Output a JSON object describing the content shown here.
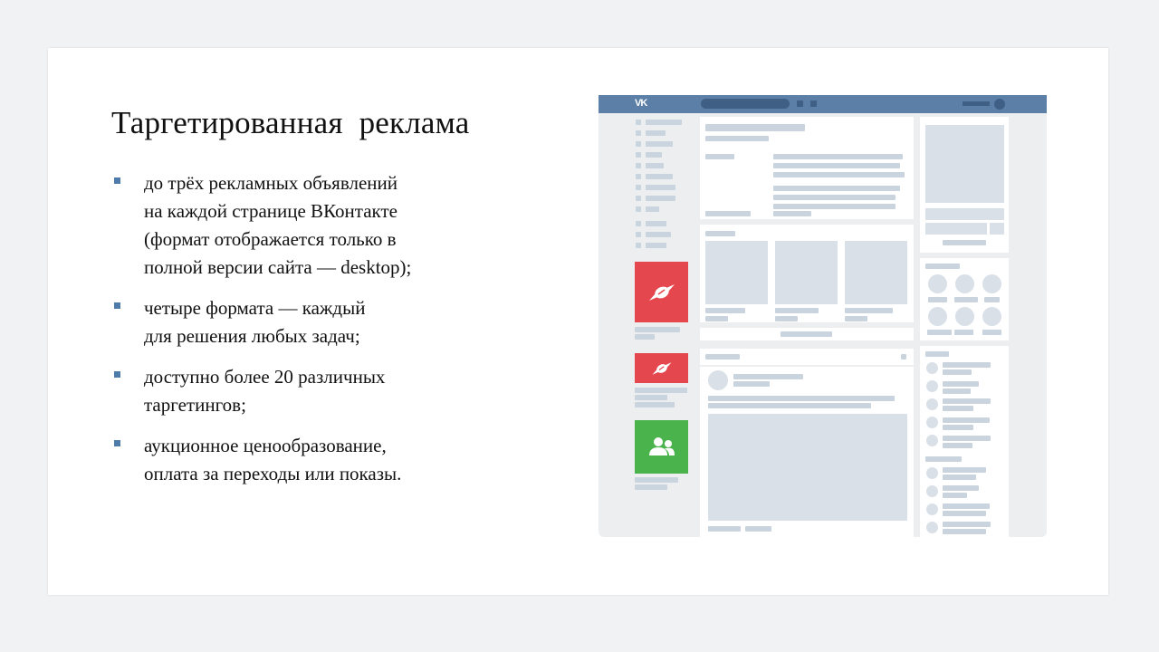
{
  "slide": {
    "title": "Таргетированная  реклама",
    "bullets": [
      {
        "lines": [
          "до трёх рекламных объявлений",
          "на каждой странице ВКонтакте",
          "(формат отображается только в",
          "полной версии сайта — desktop);"
        ]
      },
      {
        "lines": [
          "четыре формата — каждый",
          "для решения любых задач;"
        ]
      },
      {
        "lines": [
          "доступно более 20 различных",
          "таргетингов;"
        ]
      },
      {
        "lines": [
          "аукционное ценообразование,",
          "оплата за переходы или показы."
        ]
      }
    ]
  },
  "mockup": {
    "logo_text": "VK",
    "header_color": "#5b7fa6",
    "ads": [
      {
        "icon": "candy-icon",
        "color": "#e5474f"
      },
      {
        "icon": "candy-icon",
        "color": "#e5474f"
      },
      {
        "icon": "community-icon",
        "color": "#4bb34b"
      }
    ]
  }
}
